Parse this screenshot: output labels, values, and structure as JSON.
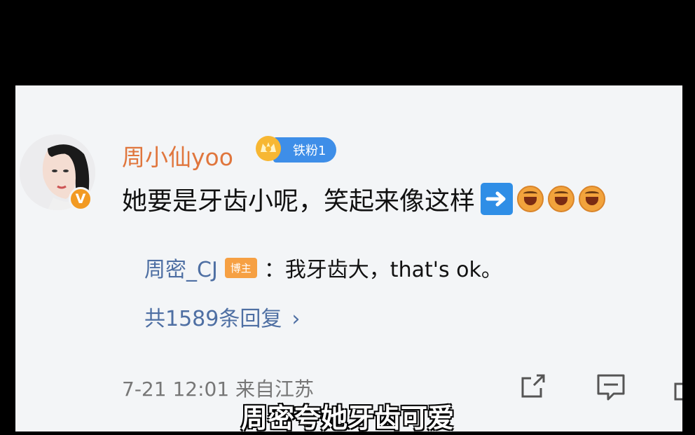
{
  "post": {
    "username": "周小仙yoo",
    "fan_badge": "铁粉1",
    "verified_badge": "V",
    "comment": "她要是牙齿小呢，笑起来像这样",
    "arrow_icon": "right-arrow-icon",
    "emoji_icon": "laughing-face-icon",
    "emoji_count": 3
  },
  "reply": {
    "user": "周密_CJ",
    "badge": "博主",
    "separator": "：",
    "text": "我牙齿大，that's ok。"
  },
  "reply_count": {
    "label": "共1589条回复",
    "chevron": "›"
  },
  "meta": {
    "text": "7-21 12:01 来自江苏"
  },
  "actions": [
    "share-icon",
    "comment-icon"
  ],
  "subtitle": "周密夸她牙齿可爱",
  "colors": {
    "username": "#e0763d",
    "link": "#4e6fa3",
    "fan_badge": "#3e8ee8",
    "op_badge": "#f6a043",
    "card_bg": "#f3f5f7"
  }
}
